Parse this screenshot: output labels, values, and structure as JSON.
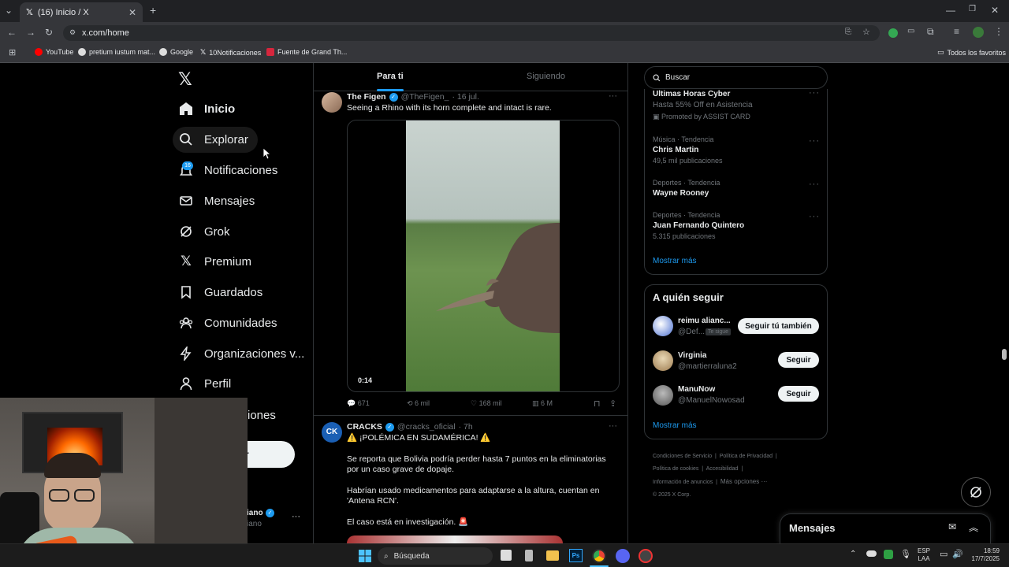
{
  "browser": {
    "tab_title": "(16) Inicio / X",
    "url": "x.com/home",
    "bookmarks": [
      "YouTube",
      "pretium iustum mat...",
      "Google",
      "10Notificaciones",
      "Fuente de Grand Th..."
    ],
    "all_bookmarks": "Todos los favoritos"
  },
  "nav": {
    "items": [
      "Inicio",
      "Explorar",
      "Notificaciones",
      "Mensajes",
      "Grok",
      "Premium",
      "Guardados",
      "Comunidades",
      "Organizaciones v...",
      "Perfil",
      "iones"
    ],
    "notif_badge": "16",
    "post_btn_fragment": "r",
    "user_name_fragment": "iano",
    "user_handle_fragment": "iano",
    "more": "···"
  },
  "feed": {
    "tabs": [
      "Para ti",
      "Siguiendo"
    ],
    "tweet1": {
      "name": "The Figen",
      "handle": "@TheFigen_",
      "time": "· 16 jul.",
      "text": "Seeing a Rhino with its horn complete and intact is rare.",
      "duration": "0:14",
      "replies": "671",
      "retweets": "6 mil",
      "likes": "168 mil",
      "views": "6 M"
    },
    "tweet2": {
      "name": "CRACKS",
      "handle": "@cracks_oficial",
      "time": "· 7h",
      "avatar_text": "CK",
      "line1": "⚠️ ¡POLÉMICA EN SUDAMÉRICA! ⚠️",
      "line2": "Se reporta que Bolivia podría perder hasta 7 puntos en la eliminatorias por un caso grave de dopaje.",
      "line3": "Habrían usado medicamentos para adaptarse a la altura, cuentan en 'Antena RCN'.",
      "line4": "El caso está en investigación. 🚨"
    }
  },
  "right": {
    "search_placeholder": "Buscar",
    "trends": [
      {
        "title": "Ultimas Horas Cyber",
        "sub": "Hasta 55% Off en Asistencia",
        "promo": "Promoted by ASSIST CARD"
      },
      {
        "cat": "Música · Tendencia",
        "name": "Chris Martin",
        "posts": "49,5 mil publicaciones"
      },
      {
        "cat": "Deportes · Tendencia",
        "name": "Wayne Rooney",
        "posts": ""
      },
      {
        "cat": "Deportes · Tendencia",
        "name": "Juan Fernando Quintero",
        "posts": "5.315 publicaciones"
      }
    ],
    "show_more": "Mostrar más",
    "who_title": "A quién seguir",
    "who": [
      {
        "name": "reimu alianc...",
        "handle": "@Def...",
        "tag": "Te sigue",
        "btn": "Seguir tú también"
      },
      {
        "name": "Virginia",
        "handle": "@martierraluna2",
        "btn": "Seguir"
      },
      {
        "name": "ManuNow",
        "handle": "@ManuelNowosad",
        "btn": "Seguir"
      }
    ],
    "who_more": "Mostrar más",
    "footer": [
      "Condiciones de Servicio",
      "Política de Privacidad",
      "Política de cookies",
      "Accesibilidad",
      "Información de anuncios",
      "Más opciones ···",
      "© 2025 X Corp."
    ],
    "messages": "Mensajes"
  },
  "taskbar": {
    "search": "Búsqueda",
    "lang1": "ESP",
    "lang2": "LAA",
    "time": "18:59",
    "date": "17/7/2025"
  }
}
